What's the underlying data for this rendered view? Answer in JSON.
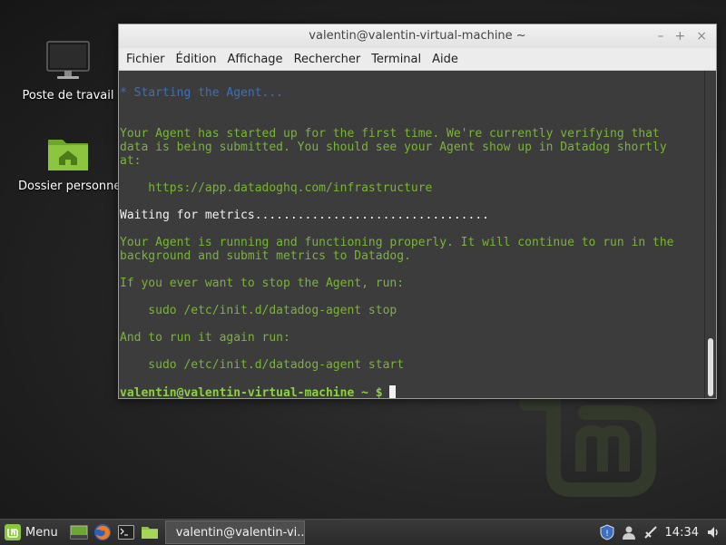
{
  "desktop": {
    "icons": [
      {
        "label": "Poste de travail",
        "icon": "computer-icon"
      },
      {
        "label": "Dossier personnel",
        "icon": "home-folder-icon"
      }
    ]
  },
  "window": {
    "title": "valentin@valentin-virtual-machine ~",
    "controls": {
      "minimize": "–",
      "maximize": "+",
      "close": "×"
    },
    "menu": [
      "Fichier",
      "Édition",
      "Affichage",
      "Rechercher",
      "Terminal",
      "Aide"
    ]
  },
  "terminal": {
    "lines": {
      "l1": "* Starting the Agent...",
      "l2": "Your Agent has started up for the first time. We're currently verifying that",
      "l3": "data is being submitted. You should see your Agent show up in Datadog shortly",
      "l4": "at:",
      "l5": "    https://app.datadoghq.com/infrastructure",
      "l6": "Waiting for metrics.................................",
      "l7": "Your Agent is running and functioning properly. It will continue to run in the",
      "l8": "background and submit metrics to Datadog.",
      "l9": "If you ever want to stop the Agent, run:",
      "l10": "    sudo /etc/init.d/datadog-agent stop",
      "l11": "And to run it again run:",
      "l12": "    sudo /etc/init.d/datadog-agent start"
    },
    "prompt": "valentin@valentin-virtual-machine ~ $"
  },
  "taskbar": {
    "menu_label": "Menu",
    "window_button": "valentin@valentin-vi...",
    "clock": "14:34"
  },
  "colors": {
    "terminal_bg": "#3c3c3c",
    "terminal_green": "#78b534",
    "terminal_blue": "#3d70b8",
    "mint_green": "#8cc63f"
  }
}
